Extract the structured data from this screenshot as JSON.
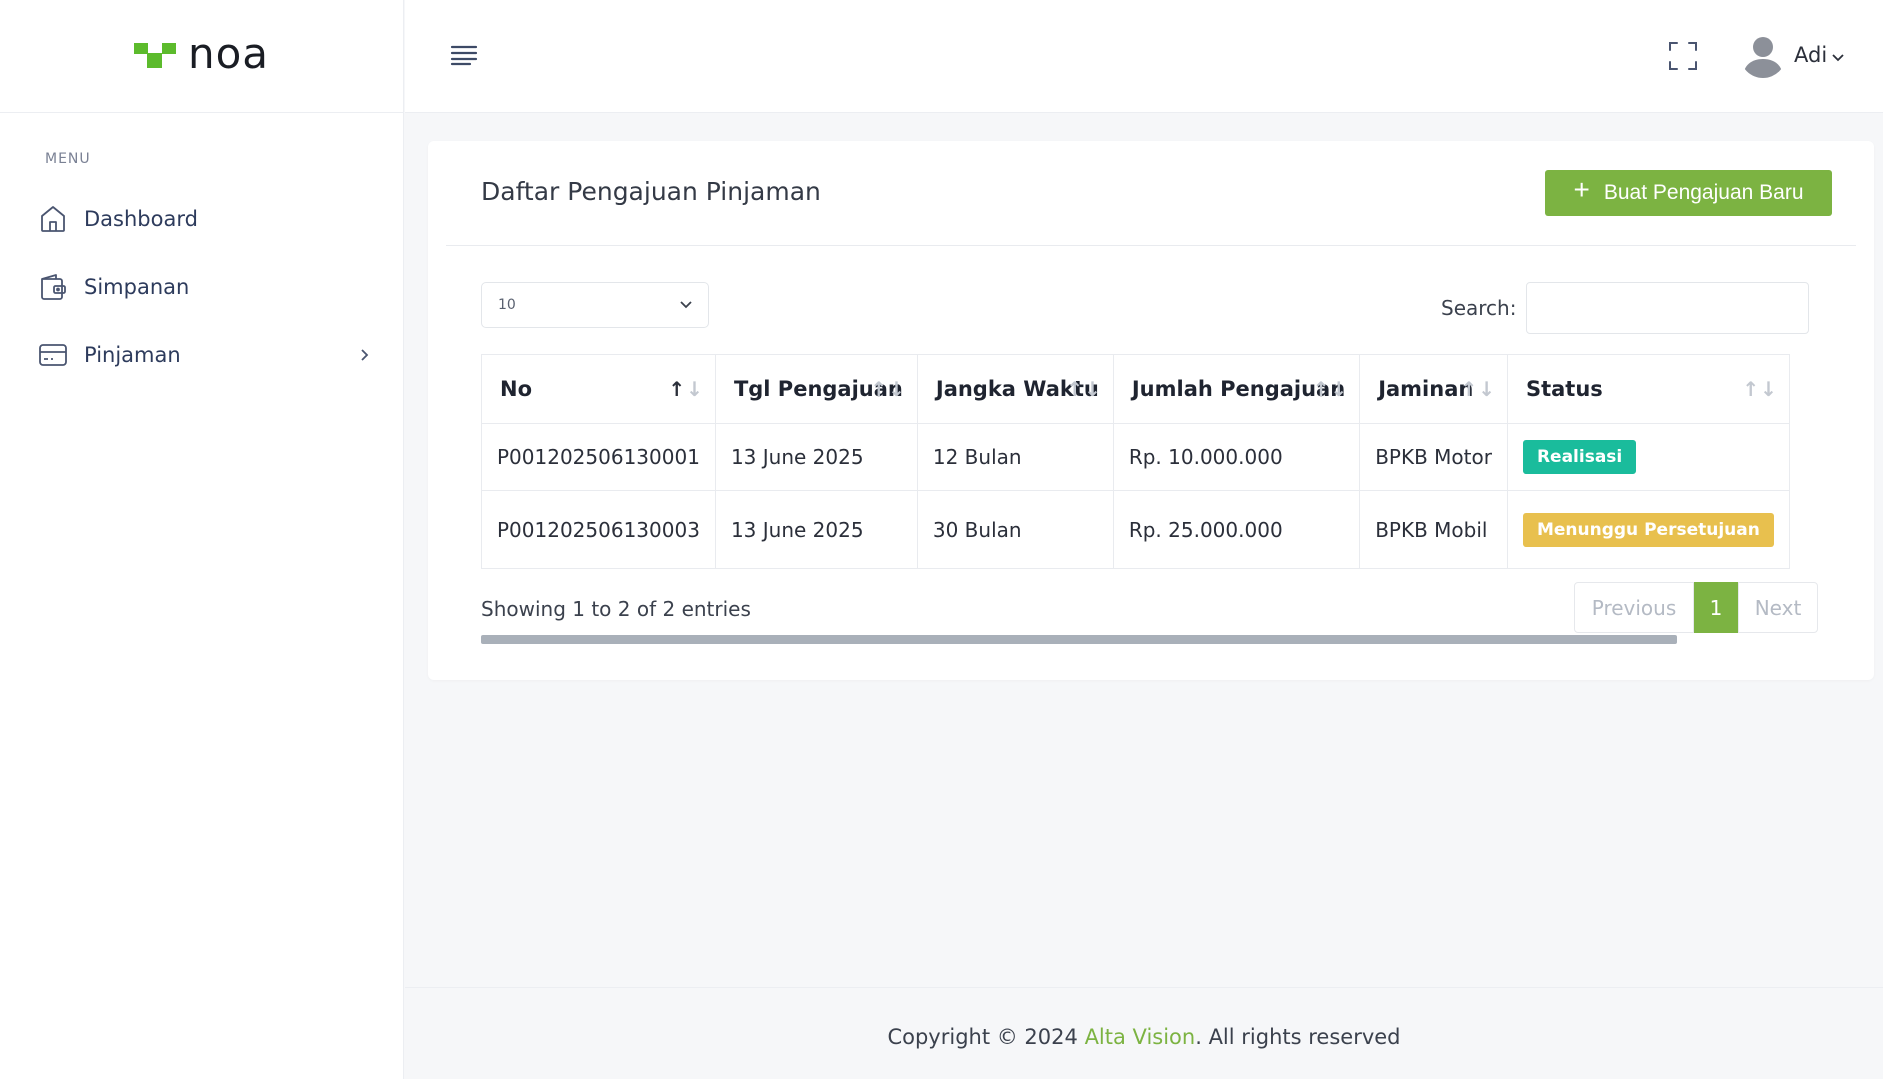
{
  "brand": {
    "name": "noa",
    "color": "#5cbb2c"
  },
  "sidebar": {
    "menu_title": "MENU",
    "items": [
      {
        "label": "Dashboard",
        "icon": "home-icon"
      },
      {
        "label": "Simpanan",
        "icon": "wallet-icon"
      },
      {
        "label": "Pinjaman",
        "icon": "credit-card-icon",
        "has_submenu": true
      }
    ]
  },
  "topbar": {
    "menu_icon": "hamburger-icon",
    "fullscreen_icon": "fullscreen-icon",
    "user": {
      "name": "Adi",
      "avatar_icon": "user-avatar-icon"
    }
  },
  "card": {
    "title": "Daftar Pengajuan Pinjaman",
    "new_button_icon": "+",
    "new_button_label": "Buat Pengajuan Baru"
  },
  "table_controls": {
    "page_length": "10",
    "search_label": "Search:",
    "search_value": ""
  },
  "table": {
    "columns": [
      "No",
      "Tgl Pengajuan",
      "Jangka Waktu",
      "Jumlah Pengajuan",
      "Jaminan",
      "Status"
    ],
    "rows": [
      {
        "no": "P001202506130001",
        "tgl": "13 June 2025",
        "jangka": "12 Bulan",
        "jumlah": "Rp. 10.000.000",
        "jaminan": "BPKB Motor",
        "status": "Realisasi",
        "status_color": "#1abc9c"
      },
      {
        "no": "P001202506130003",
        "tgl": "13 June 2025",
        "jangka": "30 Bulan",
        "jumlah": "Rp. 25.000.000",
        "jaminan": "BPKB Mobil",
        "status": "Menunggu Persetujuan",
        "status_color": "#e8c04e"
      }
    ]
  },
  "info": "Showing 1 to 2 of 2 entries",
  "pagination": {
    "previous": "Previous",
    "current": "1",
    "next": "Next"
  },
  "footer": {
    "prefix": "Copyright © 2024 ",
    "link": "Alta Vision",
    "suffix": ". All rights reserved",
    "link_color": "#7cb342"
  },
  "colors": {
    "accent": "#7cb342",
    "sidebar_text": "#2d3b5c"
  }
}
